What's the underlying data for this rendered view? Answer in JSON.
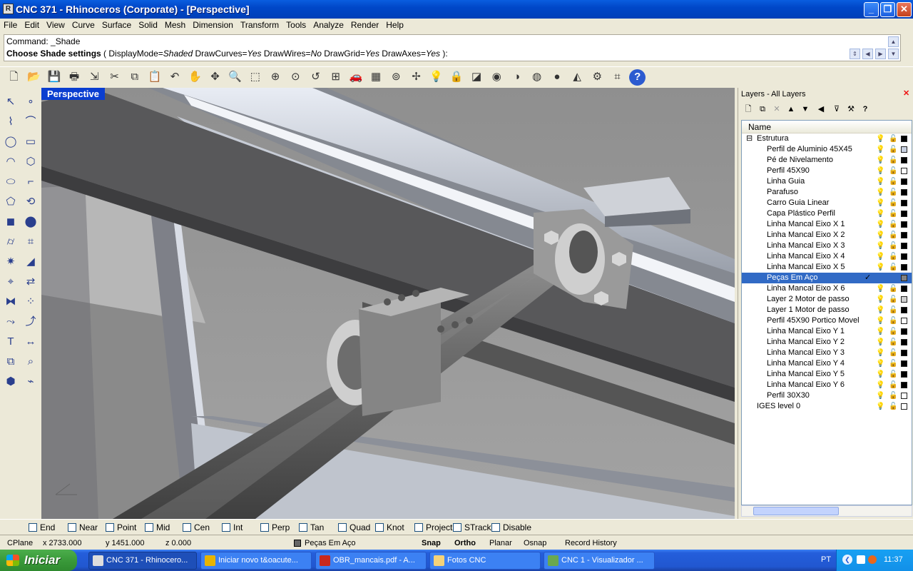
{
  "window": {
    "title": "CNC  371 - Rhinoceros (Corporate) - [Perspective]"
  },
  "menu": [
    "File",
    "Edit",
    "View",
    "Curve",
    "Surface",
    "Solid",
    "Mesh",
    "Dimension",
    "Transform",
    "Tools",
    "Analyze",
    "Render",
    "Help"
  ],
  "command": {
    "history": "Command: _Shade",
    "prompt_label": "Choose Shade settings",
    "prompt_open": " ( ",
    "options": [
      {
        "key": "DisplayMode",
        "value": "Shaded"
      },
      {
        "key": "DrawCurves",
        "value": "Yes"
      },
      {
        "key": "DrawWires",
        "value": "No"
      },
      {
        "key": "DrawGrid",
        "value": "Yes"
      },
      {
        "key": "DrawAxes",
        "value": "Yes"
      }
    ],
    "prompt_close": " ):"
  },
  "toolbar_icons": [
    "new-icon",
    "open-icon",
    "save-icon",
    "print-icon",
    "import-icon",
    "cut-icon",
    "copy-icon",
    "paste-icon",
    "undo-icon",
    "pan-icon",
    "rotate-view-icon",
    "zoom-dynamic-icon",
    "zoom-window-icon",
    "zoom-extents-icon",
    "zoom-selected-icon",
    "undo-view-icon",
    "four-viewports-icon",
    "car-icon",
    "cplane-icon",
    "osnap-icon",
    "move-icon",
    "light-icon",
    "lock-icon",
    "materials-icon",
    "color-wheel-icon",
    "shade-icon",
    "wireframe-icon",
    "render-icon",
    "render-settings-icon",
    "options-gear-icon",
    "dimensions-icon",
    "help-icon"
  ],
  "viewport": {
    "title": "Perspective"
  },
  "layers": {
    "title": "Layers - All Layers",
    "column_name": "Name",
    "items": [
      {
        "name": "Estrutura",
        "level": 0,
        "expander": "⊟",
        "color": "#000000"
      },
      {
        "name": "Perfil de Aluminio 45X45",
        "level": 1,
        "color": "#c8d0e0"
      },
      {
        "name": "Pé de Nivelamento",
        "level": 1,
        "color": "#000000"
      },
      {
        "name": "Perfil 45X90",
        "level": 1,
        "color": "#ffffff"
      },
      {
        "name": "Linha Guia",
        "level": 1,
        "color": "#000000"
      },
      {
        "name": "Parafuso",
        "level": 1,
        "color": "#000000"
      },
      {
        "name": "Carro Guia Linear",
        "level": 1,
        "color": "#000000"
      },
      {
        "name": "Capa Plástico Perfil",
        "level": 1,
        "color": "#000000"
      },
      {
        "name": "Linha Mancal Eixo X 1",
        "level": 1,
        "color": "#000000"
      },
      {
        "name": "Linha Mancal Eixo X 2",
        "level": 1,
        "color": "#000000"
      },
      {
        "name": "Linha Mancal Eixo X  3",
        "level": 1,
        "color": "#000000"
      },
      {
        "name": "Linha Mancal Eixo X  4",
        "level": 1,
        "color": "#000000"
      },
      {
        "name": "Linha Mancal Eixo X  5",
        "level": 1,
        "color": "#000000"
      },
      {
        "name": "Peças Em Aço",
        "level": 1,
        "color": "#808080",
        "selected": true,
        "current": "✓"
      },
      {
        "name": "Linha Mancal Eixo X  6",
        "level": 1,
        "color": "#000000"
      },
      {
        "name": "Layer 2 Motor de passo",
        "level": 1,
        "color": "#d0d0d0"
      },
      {
        "name": "Layer 1 Motor de passo",
        "level": 1,
        "color": "#000000"
      },
      {
        "name": "Perfil 45X90 Portico Movel",
        "level": 1,
        "color": "#ffffff"
      },
      {
        "name": "Linha Mancal Eixo Y 1",
        "level": 1,
        "color": "#000000"
      },
      {
        "name": "Linha Mancal Eixo Y 2",
        "level": 1,
        "color": "#000000"
      },
      {
        "name": "Linha Mancal Eixo Y 3",
        "level": 1,
        "color": "#000000"
      },
      {
        "name": "Linha Mancal Eixo Y 4",
        "level": 1,
        "color": "#000000"
      },
      {
        "name": "Linha Mancal Eixo Y 5",
        "level": 1,
        "color": "#000000"
      },
      {
        "name": "Linha Mancal Eixo Y 6",
        "level": 1,
        "color": "#000000"
      },
      {
        "name": "Perfil 30X30",
        "level": 1,
        "color": "#ffffff"
      },
      {
        "name": "IGES level 0",
        "level": 0,
        "color": "#ffffff"
      }
    ]
  },
  "osnaps": [
    {
      "label": "End"
    },
    {
      "label": "Near"
    },
    {
      "label": "Point"
    },
    {
      "label": "Mid"
    },
    {
      "label": "Cen"
    },
    {
      "label": "Int"
    },
    {
      "label": "Perp"
    },
    {
      "label": "Tan"
    },
    {
      "label": "Quad"
    },
    {
      "label": "Knot"
    },
    {
      "label": "Project"
    },
    {
      "label": "STrack"
    },
    {
      "label": "Disable"
    }
  ],
  "status": {
    "cplane": "CPlane",
    "x": "x 2733.000",
    "y": "y 1451.000",
    "z": "z 0.000",
    "layer": "Peças Em Aço",
    "snap": "Snap",
    "ortho": "Ortho",
    "planar": "Planar",
    "osnap": "Osnap",
    "record_history": "Record History"
  },
  "taskbar": {
    "start": "Iniciar",
    "tasks": [
      {
        "label": "CNC  371 - Rhinocero...",
        "icon": "rhino-icon",
        "active": true
      },
      {
        "label": "Iniciar novo t&oacute...",
        "icon": "chrome-icon"
      },
      {
        "label": "OBR_mancais.pdf - A...",
        "icon": "pdf-icon"
      },
      {
        "label": "Fotos CNC",
        "icon": "folder-icon"
      },
      {
        "label": "CNC 1 - Visualizador ...",
        "icon": "image-viewer-icon"
      }
    ],
    "lang": "PT",
    "clock": "11:37"
  }
}
